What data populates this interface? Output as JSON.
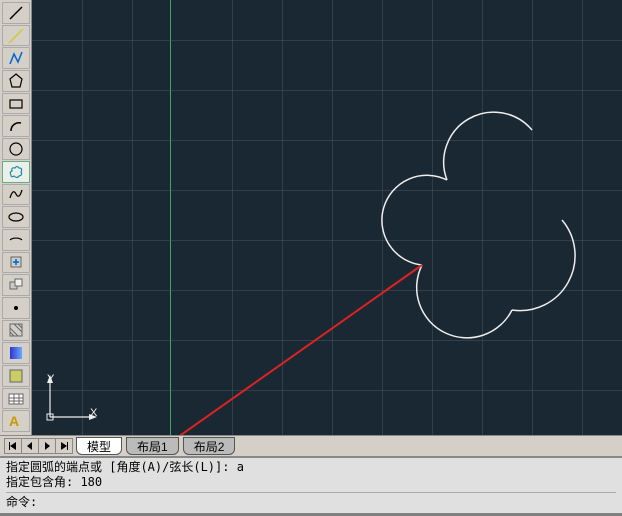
{
  "toolbar": {
    "items": [
      "line",
      "polyline",
      "polygon",
      "rectangle",
      "arc",
      "circle",
      "cloud",
      "spline",
      "ellipse",
      "ellipse-arc",
      "point",
      "hatch",
      "gradient",
      "region",
      "table",
      "text"
    ]
  },
  "canvas": {
    "axis_y": "Y",
    "axis_x": "X"
  },
  "tabs": {
    "model": "模型",
    "layout1": "布局1",
    "layout2": "布局2"
  },
  "command": {
    "line1": "指定圆弧的端点或 [角度(A)/弦长(L)]: a",
    "line2": "指定包含角: 180",
    "prompt": "命令:",
    "input_value": ""
  }
}
